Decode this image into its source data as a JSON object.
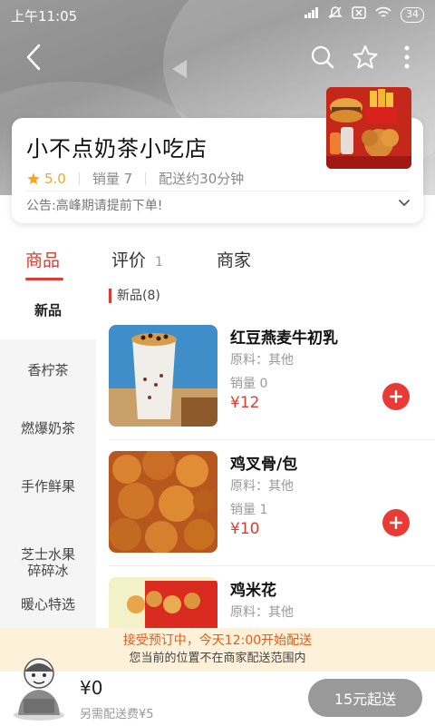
{
  "status_bar": {
    "time": "上午11:05",
    "battery": "34",
    "icons": [
      "signal-icon",
      "mute-icon",
      "close-box-icon",
      "wifi-icon",
      "battery-icon"
    ]
  },
  "nav": {
    "icons": [
      "back-icon",
      "search-icon",
      "star-icon",
      "more-icon"
    ]
  },
  "shop": {
    "name": "小不点奶茶小吃店",
    "rating": "5.0",
    "sales": "销量 7",
    "delivery_time": "配送约30分钟",
    "notice": "公告:高峰期请提前下单!"
  },
  "tabs": {
    "goods": "商品",
    "reviews": "评价",
    "reviews_count": "1",
    "merchant": "商家",
    "active": "goods"
  },
  "sidebar": {
    "items": [
      {
        "label": "新品"
      },
      {
        "label": "香柠茶"
      },
      {
        "label": "燃爆奶茶"
      },
      {
        "label": "手作鲜果"
      },
      {
        "label": "芝士水果\n碎碎冰"
      },
      {
        "label": "暖心特选"
      }
    ]
  },
  "section": {
    "title": "新品(8)"
  },
  "products": [
    {
      "name": "红豆燕麦牛初乳",
      "ingredients": "原料：其他",
      "sales": "销量 0",
      "price": "¥12"
    },
    {
      "name": "鸡叉骨/包",
      "ingredients": "原料：其他",
      "sales": "销量 1",
      "price": "¥10"
    },
    {
      "name": "鸡米花",
      "ingredients": "原料：其他",
      "sales": "",
      "price": ""
    }
  ],
  "delivery_banner": {
    "line1": "接受预订中，今天12:00开始配送",
    "line2": "您当前的位置不在商家配送范围内"
  },
  "cart": {
    "total": "¥0",
    "delivery_fee": "另需配送费¥5",
    "checkout": "15元起送"
  },
  "colors": {
    "accent": "#e03a2c",
    "rating": "#f5a623",
    "banner_bg": "#fdf2d9",
    "banner_text": "#e65a1d",
    "checkout_bg": "#999999"
  }
}
